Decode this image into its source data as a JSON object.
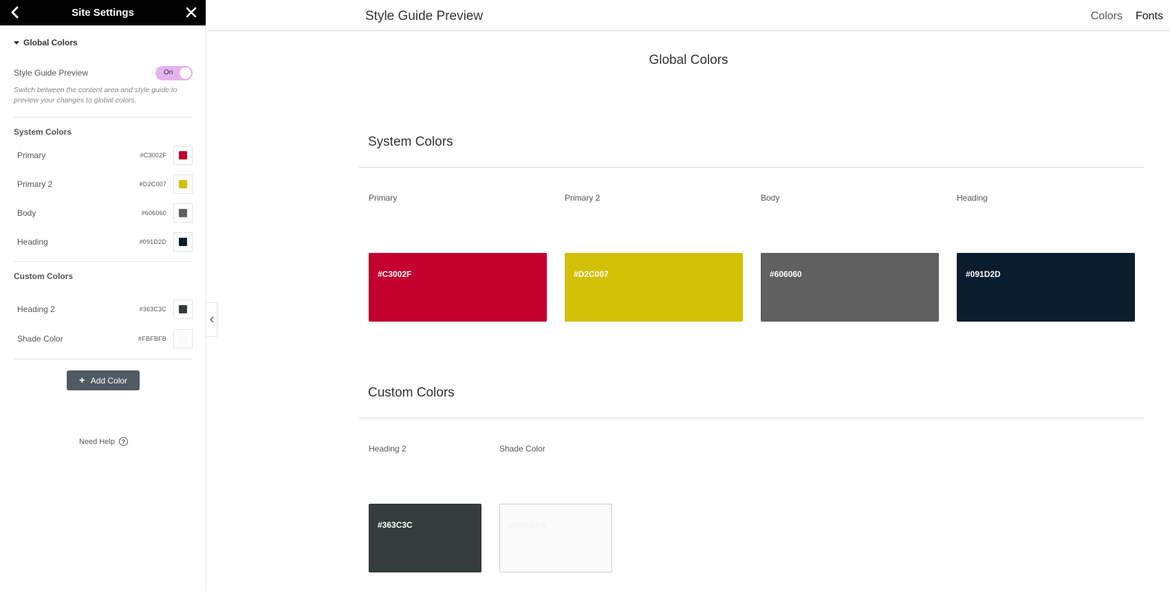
{
  "sidebar": {
    "title": "Site Settings",
    "back_icon": "chevron-left-icon",
    "close_icon": "close-icon",
    "section_label": "Global Colors",
    "style_guide": {
      "label": "Style Guide Preview",
      "toggle_text": "On",
      "description": "Switch between the content area and style guide to preview your changes to global colors."
    },
    "system_colors_title": "System Colors",
    "system_colors": [
      {
        "name": "Primary",
        "hex": "#C3002F",
        "color": "#C3002F"
      },
      {
        "name": "Primary 2",
        "hex": "#D2C007",
        "color": "#D2C007"
      },
      {
        "name": "Body",
        "hex": "#606060",
        "color": "#606060"
      },
      {
        "name": "Heading",
        "hex": "#091D2D",
        "color": "#091D2D"
      }
    ],
    "custom_colors_title": "Custom Colors",
    "custom_colors": [
      {
        "name": "Heading 2",
        "hex": "#363C3C",
        "color": "#363C3C"
      },
      {
        "name": "Shade Color",
        "hex": "#FBFBFB",
        "color": "#FBFBFB"
      }
    ],
    "add_color_label": "Add Color",
    "need_help_label": "Need Help",
    "help_icon": "?"
  },
  "topbar": {
    "page_title": "Style Guide Preview",
    "tabs": [
      "Colors",
      "Fonts"
    ]
  },
  "main": {
    "heading": "Global Colors",
    "system_section_title": "System Colors",
    "system_cards": [
      {
        "label": "Primary",
        "hex": "#C3002F",
        "color": "#C3002F"
      },
      {
        "label": "Primary 2",
        "hex": "#D2C007",
        "color": "#D2C007"
      },
      {
        "label": "Body",
        "hex": "#606060",
        "color": "#606060"
      },
      {
        "label": "Heading",
        "hex": "#091D2D",
        "color": "#091D2D"
      }
    ],
    "custom_section_title": "Custom Colors",
    "custom_cards": [
      {
        "label": "Heading 2",
        "hex": "#363C3C",
        "color": "#363C3C"
      },
      {
        "label": "Shade Color",
        "hex": "#FBFBFB",
        "color": "#FBFBFB"
      }
    ]
  }
}
